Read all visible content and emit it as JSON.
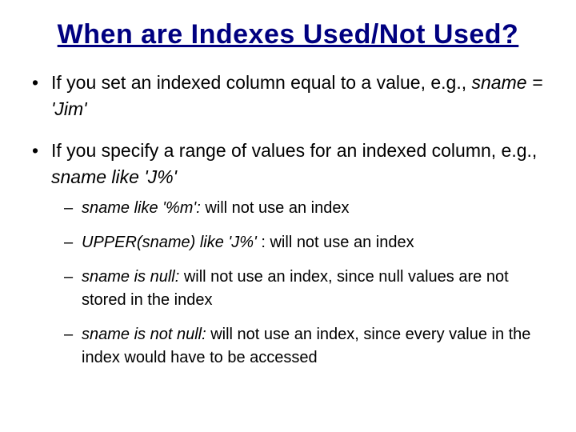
{
  "title": "When are Indexes Used/Not Used?",
  "bullets": [
    {
      "pre": "If you set an indexed column equal to a value, e.g., ",
      "em": "sname = 'Jim'",
      "post": ""
    },
    {
      "pre": "If you specify a range of values for an indexed column, e.g., ",
      "em": "sname like 'J%'",
      "post": "",
      "sub": [
        {
          "em": "sname like '%m':",
          "post": " will not use an index"
        },
        {
          "em": "UPPER(sname) like 'J%'",
          "post": " : will not use an index"
        },
        {
          "em": "sname is null:",
          "post": " will not use an index, since null values are not stored in the index"
        },
        {
          "em": "sname is not null:",
          "post": " will not use an index, since every value in the index would have to be accessed"
        }
      ]
    }
  ]
}
